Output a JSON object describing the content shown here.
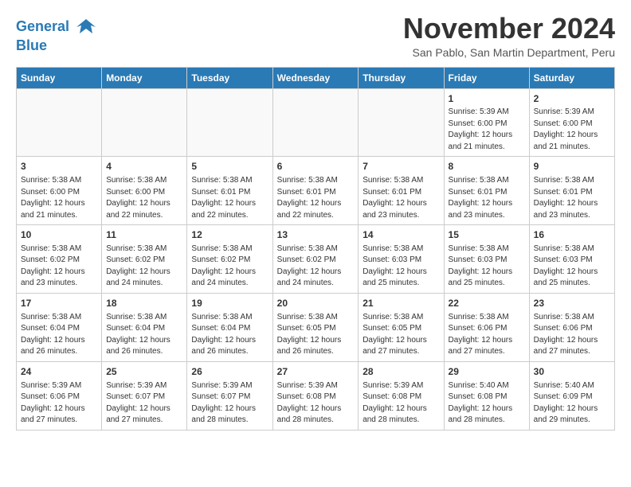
{
  "header": {
    "logo_line1": "General",
    "logo_line2": "Blue",
    "month_title": "November 2024",
    "subtitle": "San Pablo, San Martin Department, Peru"
  },
  "weekdays": [
    "Sunday",
    "Monday",
    "Tuesday",
    "Wednesday",
    "Thursday",
    "Friday",
    "Saturday"
  ],
  "weeks": [
    [
      {
        "day": "",
        "info": ""
      },
      {
        "day": "",
        "info": ""
      },
      {
        "day": "",
        "info": ""
      },
      {
        "day": "",
        "info": ""
      },
      {
        "day": "",
        "info": ""
      },
      {
        "day": "1",
        "info": "Sunrise: 5:39 AM\nSunset: 6:00 PM\nDaylight: 12 hours and 21 minutes."
      },
      {
        "day": "2",
        "info": "Sunrise: 5:39 AM\nSunset: 6:00 PM\nDaylight: 12 hours and 21 minutes."
      }
    ],
    [
      {
        "day": "3",
        "info": "Sunrise: 5:38 AM\nSunset: 6:00 PM\nDaylight: 12 hours and 21 minutes."
      },
      {
        "day": "4",
        "info": "Sunrise: 5:38 AM\nSunset: 6:00 PM\nDaylight: 12 hours and 22 minutes."
      },
      {
        "day": "5",
        "info": "Sunrise: 5:38 AM\nSunset: 6:01 PM\nDaylight: 12 hours and 22 minutes."
      },
      {
        "day": "6",
        "info": "Sunrise: 5:38 AM\nSunset: 6:01 PM\nDaylight: 12 hours and 22 minutes."
      },
      {
        "day": "7",
        "info": "Sunrise: 5:38 AM\nSunset: 6:01 PM\nDaylight: 12 hours and 23 minutes."
      },
      {
        "day": "8",
        "info": "Sunrise: 5:38 AM\nSunset: 6:01 PM\nDaylight: 12 hours and 23 minutes."
      },
      {
        "day": "9",
        "info": "Sunrise: 5:38 AM\nSunset: 6:01 PM\nDaylight: 12 hours and 23 minutes."
      }
    ],
    [
      {
        "day": "10",
        "info": "Sunrise: 5:38 AM\nSunset: 6:02 PM\nDaylight: 12 hours and 23 minutes."
      },
      {
        "day": "11",
        "info": "Sunrise: 5:38 AM\nSunset: 6:02 PM\nDaylight: 12 hours and 24 minutes."
      },
      {
        "day": "12",
        "info": "Sunrise: 5:38 AM\nSunset: 6:02 PM\nDaylight: 12 hours and 24 minutes."
      },
      {
        "day": "13",
        "info": "Sunrise: 5:38 AM\nSunset: 6:02 PM\nDaylight: 12 hours and 24 minutes."
      },
      {
        "day": "14",
        "info": "Sunrise: 5:38 AM\nSunset: 6:03 PM\nDaylight: 12 hours and 25 minutes."
      },
      {
        "day": "15",
        "info": "Sunrise: 5:38 AM\nSunset: 6:03 PM\nDaylight: 12 hours and 25 minutes."
      },
      {
        "day": "16",
        "info": "Sunrise: 5:38 AM\nSunset: 6:03 PM\nDaylight: 12 hours and 25 minutes."
      }
    ],
    [
      {
        "day": "17",
        "info": "Sunrise: 5:38 AM\nSunset: 6:04 PM\nDaylight: 12 hours and 26 minutes."
      },
      {
        "day": "18",
        "info": "Sunrise: 5:38 AM\nSunset: 6:04 PM\nDaylight: 12 hours and 26 minutes."
      },
      {
        "day": "19",
        "info": "Sunrise: 5:38 AM\nSunset: 6:04 PM\nDaylight: 12 hours and 26 minutes."
      },
      {
        "day": "20",
        "info": "Sunrise: 5:38 AM\nSunset: 6:05 PM\nDaylight: 12 hours and 26 minutes."
      },
      {
        "day": "21",
        "info": "Sunrise: 5:38 AM\nSunset: 6:05 PM\nDaylight: 12 hours and 27 minutes."
      },
      {
        "day": "22",
        "info": "Sunrise: 5:38 AM\nSunset: 6:06 PM\nDaylight: 12 hours and 27 minutes."
      },
      {
        "day": "23",
        "info": "Sunrise: 5:38 AM\nSunset: 6:06 PM\nDaylight: 12 hours and 27 minutes."
      }
    ],
    [
      {
        "day": "24",
        "info": "Sunrise: 5:39 AM\nSunset: 6:06 PM\nDaylight: 12 hours and 27 minutes."
      },
      {
        "day": "25",
        "info": "Sunrise: 5:39 AM\nSunset: 6:07 PM\nDaylight: 12 hours and 27 minutes."
      },
      {
        "day": "26",
        "info": "Sunrise: 5:39 AM\nSunset: 6:07 PM\nDaylight: 12 hours and 28 minutes."
      },
      {
        "day": "27",
        "info": "Sunrise: 5:39 AM\nSunset: 6:08 PM\nDaylight: 12 hours and 28 minutes."
      },
      {
        "day": "28",
        "info": "Sunrise: 5:39 AM\nSunset: 6:08 PM\nDaylight: 12 hours and 28 minutes."
      },
      {
        "day": "29",
        "info": "Sunrise: 5:40 AM\nSunset: 6:08 PM\nDaylight: 12 hours and 28 minutes."
      },
      {
        "day": "30",
        "info": "Sunrise: 5:40 AM\nSunset: 6:09 PM\nDaylight: 12 hours and 29 minutes."
      }
    ]
  ]
}
